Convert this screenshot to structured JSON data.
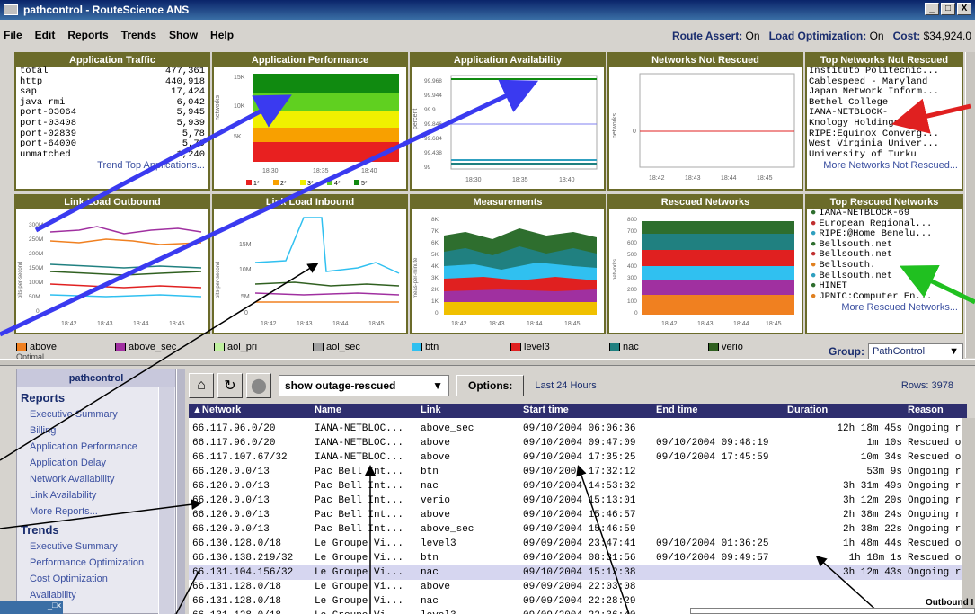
{
  "window": {
    "title": "pathcontrol - RouteScience ANS",
    "controls": [
      "_",
      "□",
      "X"
    ]
  },
  "menu": [
    "File",
    "Edit",
    "Reports",
    "Trends",
    "Show",
    "Help"
  ],
  "status": {
    "route_assert_label": "Route Assert:",
    "route_assert_value": "On",
    "load_opt_label": "Load Optimization:",
    "load_opt_value": "On",
    "cost_label": "Cost:",
    "cost_value": "$34,924.0"
  },
  "panels": {
    "app_traffic": {
      "title": "Application Traffic",
      "rows": [
        [
          "total",
          "477,361"
        ],
        [
          "http",
          "440,918"
        ],
        [
          "sap",
          "17,424"
        ],
        [
          "java rmi",
          "6,042"
        ],
        [
          "port-03064",
          "5,945"
        ],
        [
          "port-03408",
          "5,939"
        ],
        [
          "port-02839",
          "5,78"
        ],
        [
          "port-64000",
          "5,79"
        ],
        [
          "unmatched",
          "1,240"
        ]
      ],
      "link": "Trend Top Applications..."
    },
    "app_perf": {
      "title": "Application Performance",
      "yticks": [
        "15K",
        "10K",
        "5K"
      ],
      "xticks": [
        "18:30",
        "18:35",
        "18:40"
      ],
      "ylabel": "networks",
      "legend": [
        "1*",
        "2*",
        "3*",
        "4*",
        "5*"
      ]
    },
    "app_avail": {
      "title": "Application Availability",
      "yticks": [
        "99.968",
        "99.944",
        "99.9",
        "99.846",
        "99.684",
        "99.438",
        "99"
      ],
      "ylabel": "percent",
      "xticks": [
        "18:30",
        "18:35",
        "18:40"
      ]
    },
    "not_rescued": {
      "title": "Networks Not Rescued",
      "ylabel": "networks",
      "ytick": "0",
      "xticks": [
        "18:42",
        "18:43",
        "18:44",
        "18:45"
      ]
    },
    "top_not_rescued": {
      "title": "Top Networks Not Rescued",
      "items": [
        "Instituto Politecnic...",
        "Cablespeed - Maryland",
        "Japan Network Inform...",
        "Bethel College",
        "IANA-NETBLOCK-",
        "Knology Holdings",
        "RIPE:Equinox Converg...",
        "West Virginia Univer...",
        "University of Turku"
      ],
      "link": "More Networks Not Rescued..."
    },
    "link_out": {
      "title": "Link Load Outbound",
      "yticks": [
        "300M",
        "250M",
        "200M",
        "150M",
        "100M",
        "50M",
        "0"
      ],
      "ylabel": "bits-per-second",
      "xticks": [
        "18:42",
        "18:43",
        "18:44",
        "18:45"
      ]
    },
    "link_in": {
      "title": "Link Load Inbound",
      "yticks": [
        "15M",
        "10M",
        "5M",
        "0"
      ],
      "ylabel": "bits-per-second",
      "xticks": [
        "18:42",
        "18:43",
        "18:44",
        "18:45"
      ]
    },
    "measurements": {
      "title": "Measurements",
      "yticks": [
        "8K",
        "7K",
        "6K",
        "5K",
        "4K",
        "3K",
        "2K",
        "1K",
        "0"
      ],
      "ylabel": "meas-per-minute",
      "xticks": [
        "18:42",
        "18:43",
        "18:44",
        "18:45"
      ]
    },
    "rescued": {
      "title": "Rescued Networks",
      "yticks": [
        "800",
        "700",
        "600",
        "500",
        "400",
        "300",
        "200",
        "100",
        "0"
      ],
      "ylabel": "networks",
      "xticks": [
        "18:42",
        "18:43",
        "18:44",
        "18:45"
      ]
    },
    "top_rescued": {
      "title": "Top Rescued Networks",
      "items": [
        [
          "IANA-NETBLOCK-69",
          "#2e6e2e"
        ],
        [
          "European Regional...",
          "#c03030"
        ],
        [
          "RIPE:@Home Benelu...",
          "#30a0c0"
        ],
        [
          "Bellsouth.net",
          "#2e6e2e"
        ],
        [
          "Bellsouth.net",
          "#c03030"
        ],
        [
          "Bellsouth.",
          "#e08020"
        ],
        [
          "Bellsouth.net",
          "#30a0c0"
        ],
        [
          "HINET",
          "#2e6e2e"
        ],
        [
          "JPNIC:Computer En...",
          "#e08020"
        ]
      ],
      "link": "More Rescued Networks..."
    }
  },
  "legend": [
    [
      "above",
      "#f08020"
    ],
    [
      "above_sec",
      "#a030a0"
    ],
    [
      "aol_pri",
      "#c0f0a0"
    ],
    [
      "aol_sec",
      "#a0a0a0"
    ],
    [
      "btn",
      "#30c0f0"
    ],
    [
      "level3",
      "#e02020"
    ],
    [
      "nac",
      "#208080"
    ],
    [
      "verio",
      "#306020"
    ]
  ],
  "legend_extra": "Optimal",
  "group": {
    "label": "Group:",
    "value": "PathControl"
  },
  "sidebar": {
    "title": "pathcontrol",
    "sections": [
      {
        "name": "Reports",
        "items": [
          "Executive Summary",
          "Billing",
          "Application Performance",
          "Application Delay",
          "Network Availability",
          "Link Availability",
          "More Reports..."
        ]
      },
      {
        "name": "Trends",
        "items": [
          "Executive Summary",
          "Performance Optimization",
          "Cost Optimization",
          "Availability"
        ]
      }
    ]
  },
  "toolbar": {
    "view": "show outage-rescued",
    "options": "Options:",
    "range": "Last 24 Hours",
    "rows": "Rows: 3978"
  },
  "table": {
    "headers": [
      "▲Network",
      "Name",
      "Link",
      "Start time",
      "End time",
      "Duration",
      "Reason"
    ],
    "rows": [
      [
        "66.117.96.0/20",
        "IANA-NETBLOC...",
        "above_sec",
        "09/10/2004 06:06:36",
        "",
        "12h 18m 45s",
        "Ongoing re"
      ],
      [
        "66.117.96.0/20",
        "IANA-NETBLOC...",
        "above",
        "09/10/2004 09:47:09",
        "09/10/2004 09:48:19",
        "1m 10s",
        "Rescued ou"
      ],
      [
        "66.117.107.67/32",
        "IANA-NETBLOC...",
        "above",
        "09/10/2004 17:35:25",
        "09/10/2004 17:45:59",
        "10m 34s",
        "Rescued ou"
      ],
      [
        "66.120.0.0/13",
        "Pac Bell Int...",
        "btn",
        "09/10/2004 17:32:12",
        "",
        "53m 9s",
        "Ongoing re"
      ],
      [
        "66.120.0.0/13",
        "Pac Bell Int...",
        "nac",
        "09/10/2004 14:53:32",
        "",
        "3h 31m 49s",
        "Ongoing re"
      ],
      [
        "66.120.0.0/13",
        "Pac Bell Int...",
        "verio",
        "09/10/2004 15:13:01",
        "",
        "3h 12m 20s",
        "Ongoing re"
      ],
      [
        "66.120.0.0/13",
        "Pac Bell Int...",
        "above",
        "09/10/2004 15:46:57",
        "",
        "2h 38m 24s",
        "Ongoing re"
      ],
      [
        "66.120.0.0/13",
        "Pac Bell Int...",
        "above_sec",
        "09/10/2004 15:46:59",
        "",
        "2h 38m 22s",
        "Ongoing re"
      ],
      [
        "66.130.128.0/18",
        "Le Groupe Vi...",
        "level3",
        "09/09/2004 23:47:41",
        "09/10/2004 01:36:25",
        "1h 48m 44s",
        "Rescued ou"
      ],
      [
        "66.130.138.219/32",
        "Le Groupe Vi...",
        "btn",
        "09/10/2004 08:31:56",
        "09/10/2004 09:49:57",
        "1h 18m 1s",
        "Rescued ou"
      ],
      [
        "66.131.104.156/32",
        "Le Groupe Vi...",
        "nac",
        "09/10/2004 15:12:38",
        "",
        "3h 12m 43s",
        "Ongoing re"
      ],
      [
        "66.131.128.0/18",
        "Le Groupe Vi...",
        "above",
        "09/09/2004 22:03:08",
        "",
        "",
        ""
      ],
      [
        "66.131.128.0/18",
        "Le Groupe Vi...",
        "nac",
        "09/09/2004 22:28:29",
        "",
        "",
        ""
      ],
      [
        "66.131.128.0/18",
        "Le Groupe Vi...",
        "level3",
        "09/09/2004 22:36:40",
        "",
        "",
        ""
      ]
    ]
  },
  "outbound_label": "Outbound I"
}
